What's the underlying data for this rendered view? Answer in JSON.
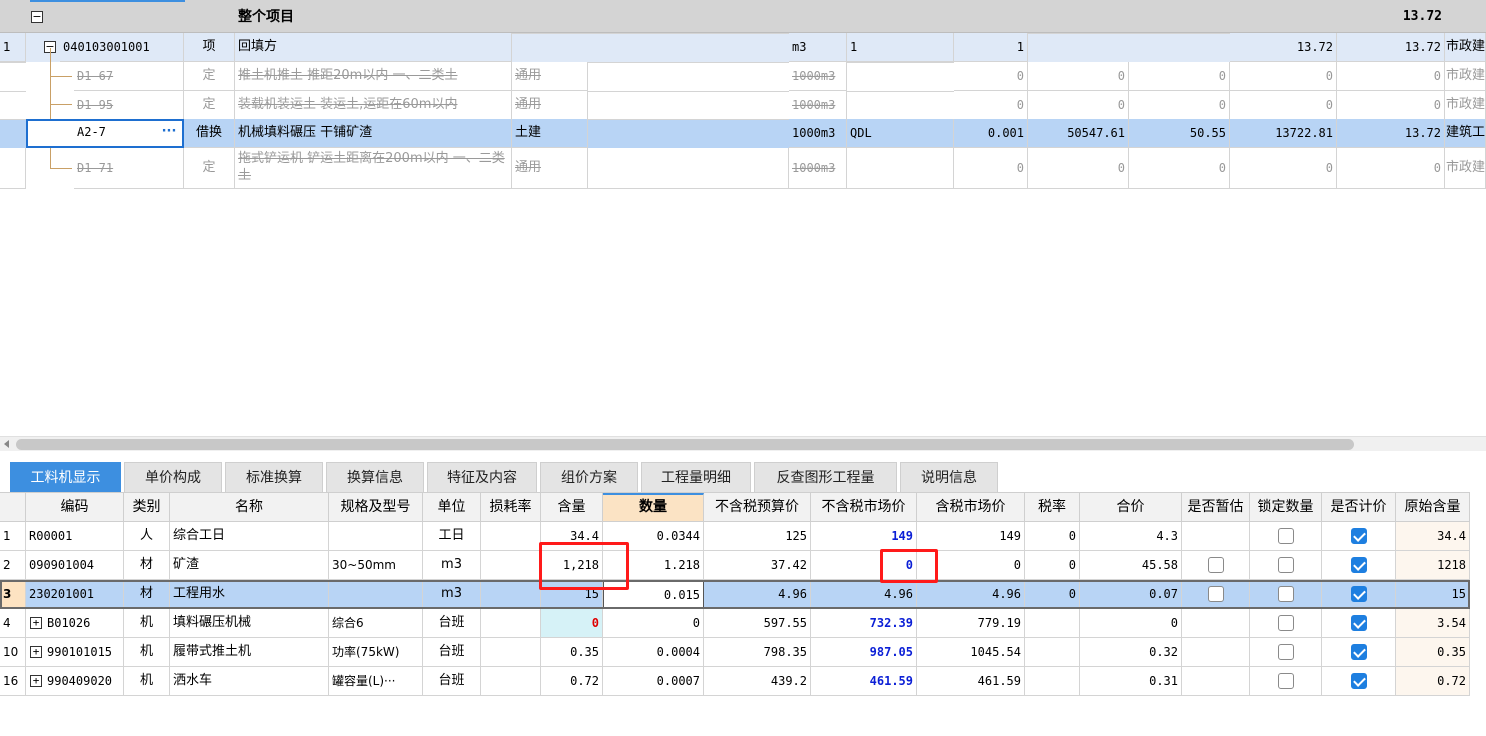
{
  "top_table": {
    "summary": {
      "expand": "−",
      "label": "整个项目",
      "total": "13.72"
    },
    "rows": [
      {
        "num": "1",
        "code": "040103001001",
        "type": "项",
        "name": "回填方",
        "spec": "",
        "unit": "m3",
        "expr": "1",
        "qty": "1",
        "p1": "",
        "p2": "",
        "p3": "13.72",
        "p4": "13.72",
        "cat": "市政建"
      },
      {
        "num": "",
        "code": "D1-67",
        "type": "定",
        "name": "推土机推土 推距20m以内  一、二类土",
        "spec": "通用",
        "unit": "1000m3",
        "expr": "",
        "qty": "0",
        "p1": "0",
        "p2": "0",
        "p3": "0",
        "p4": "0",
        "cat": "市政建"
      },
      {
        "num": "",
        "code": "D1-95",
        "type": "定",
        "name": "装载机装运土 装运土,运距在60m以内",
        "spec": "通用",
        "unit": "1000m3",
        "expr": "",
        "qty": "0",
        "p1": "0",
        "p2": "0",
        "p3": "0",
        "p4": "0",
        "cat": "市政建"
      },
      {
        "num": "",
        "code": "A2-7",
        "type": "借换",
        "name": "机械填料碾压 干铺矿渣",
        "spec": "土建",
        "unit": "1000m3",
        "expr": "QDL",
        "qty": "0.001",
        "p1": "50547.61",
        "p2": "50.55",
        "p3": "13722.81",
        "p4": "13.72",
        "cat": "建筑工",
        "more": "···"
      },
      {
        "num": "",
        "code": "D1-71",
        "type": "定",
        "name": "拖式铲运机 铲运土距离在200m以内  一、二类土",
        "spec": "通用",
        "unit": "1000m3",
        "expr": "",
        "qty": "0",
        "p1": "0",
        "p2": "0",
        "p3": "0",
        "p4": "0",
        "cat": "市政建"
      }
    ]
  },
  "tabs": [
    "工料机显示",
    "单价构成",
    "标准换算",
    "换算信息",
    "特征及内容",
    "组价方案",
    "工程量明细",
    "反查图形工程量",
    "说明信息"
  ],
  "bottom_table": {
    "headers": [
      "编码",
      "类别",
      "名称",
      "规格及型号",
      "单位",
      "损耗率",
      "含量",
      "数量",
      "不含税预算价",
      "不含税市场价",
      "含税市场价",
      "税率",
      "合价",
      "是否暂估",
      "锁定数量",
      "是否计价",
      "原始含量"
    ],
    "rows": [
      {
        "num": "1",
        "code": "R00001",
        "cat": "人",
        "name": "综合工日",
        "spec": "",
        "unit": "工日",
        "loss": "",
        "content": "34.4",
        "qty": "0.0344",
        "budget": "125",
        "market": "149",
        "market_tax": "149",
        "tax": "0",
        "total": "4.3",
        "est": null,
        "lock": false,
        "price": true,
        "orig": "34.4"
      },
      {
        "num": "2",
        "code": "090901004",
        "cat": "材",
        "name": "矿渣",
        "spec": "30~50mm",
        "unit": "m3",
        "loss": "",
        "content": "1,218",
        "qty": "1.218",
        "budget": "37.42",
        "market": "0",
        "market_tax": "0",
        "tax": "0",
        "total": "45.58",
        "est": false,
        "lock": false,
        "price": true,
        "orig": "1218"
      },
      {
        "num": "3",
        "code": "230201001",
        "cat": "材",
        "name": "工程用水",
        "spec": "",
        "unit": "m3",
        "loss": "",
        "content": "15",
        "qty": "0.015",
        "budget": "4.96",
        "market": "4.96",
        "market_tax": "4.96",
        "tax": "0",
        "total": "0.07",
        "est": false,
        "lock": false,
        "price": true,
        "orig": "15"
      },
      {
        "num": "4",
        "code": "B01026",
        "cat": "机",
        "name": "填料碾压机械",
        "spec": "综合6",
        "unit": "台班",
        "loss": "",
        "content": "0",
        "qty": "0",
        "budget": "597.55",
        "market": "732.39",
        "market_tax": "779.19",
        "tax": "",
        "total": "0",
        "est": null,
        "lock": false,
        "price": true,
        "orig": "3.54",
        "expand": "+"
      },
      {
        "num": "10",
        "code": "990101015",
        "cat": "机",
        "name": "履带式推土机",
        "spec": "功率(75kW)",
        "unit": "台班",
        "loss": "",
        "content": "0.35",
        "qty": "0.0004",
        "budget": "798.35",
        "market": "987.05",
        "market_tax": "1045.54",
        "tax": "",
        "total": "0.32",
        "est": null,
        "lock": false,
        "price": true,
        "orig": "0.35",
        "expand": "+"
      },
      {
        "num": "16",
        "code": "990409020",
        "cat": "机",
        "name": "洒水车",
        "spec": "罐容量(L)···",
        "unit": "台班",
        "loss": "",
        "content": "0.72",
        "qty": "0.0007",
        "budget": "439.2",
        "market": "461.59",
        "market_tax": "461.59",
        "tax": "",
        "total": "0.31",
        "est": null,
        "lock": false,
        "price": true,
        "orig": "0.72",
        "expand": "+"
      }
    ]
  },
  "colors": {
    "selected_row": "#b8d4f5",
    "accent": "#3d8fe0",
    "highlight_red": "#ff1a1a",
    "blue_value": "#0b1fd6"
  }
}
